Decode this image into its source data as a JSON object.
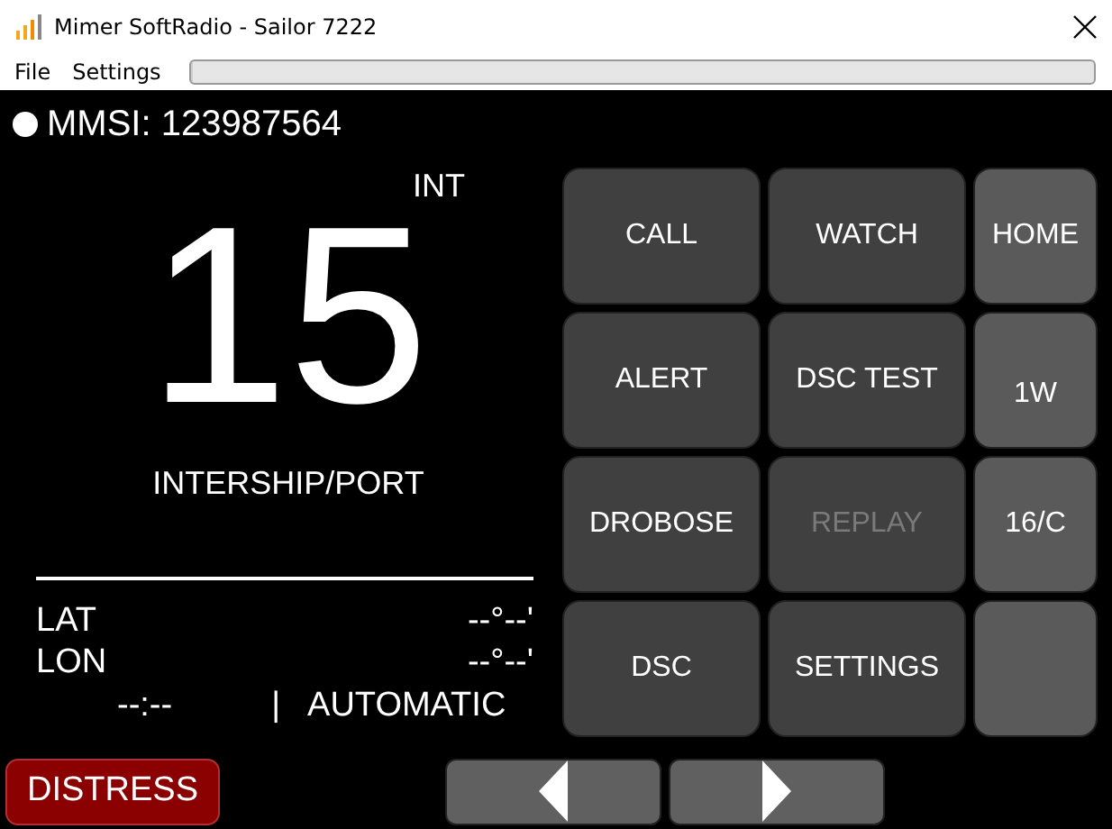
{
  "window": {
    "title": "Mimer SoftRadio - Sailor 7222"
  },
  "menu": [
    "File",
    "Settings"
  ],
  "progress": {
    "level": 0
  },
  "mmsi": {
    "label": "MMSI: 123987564"
  },
  "channel": {
    "mode": "INT",
    "number": "15",
    "name": "INTERSHIP/PORT"
  },
  "position": [
    {
      "label": "LAT",
      "value": "--°--'"
    },
    {
      "label": "LON",
      "value": "--°--'"
    }
  ],
  "status": {
    "time": "--:--",
    "separator": "|",
    "mode": "AUTOMATIC"
  },
  "buttons": [
    {
      "label": "CALL",
      "kind": "main",
      "disabled": false
    },
    {
      "label": "WATCH",
      "kind": "main",
      "disabled": false
    },
    {
      "label": "HOME",
      "kind": "side",
      "disabled": false
    },
    {
      "label": "ALERT",
      "kind": "main",
      "disabled": false
    },
    {
      "label": "DSC TEST",
      "kind": "main",
      "disabled": false
    },
    {
      "label": "1W",
      "kind": "side",
      "disabled": false
    },
    {
      "label": "DROBOSE",
      "kind": "main",
      "disabled": false
    },
    {
      "label": "REPLAY",
      "kind": "main",
      "disabled": true
    },
    {
      "label": "16/C",
      "kind": "side",
      "disabled": false
    },
    {
      "label": "DSC",
      "kind": "main",
      "disabled": false
    },
    {
      "label": "SETTINGS",
      "kind": "main",
      "disabled": false
    },
    {
      "kind": "side"
    }
  ],
  "distress": {
    "label": "DISTRESS"
  },
  "nav": [
    {
      "kind": "left"
    },
    {
      "kind": "right"
    }
  ]
}
